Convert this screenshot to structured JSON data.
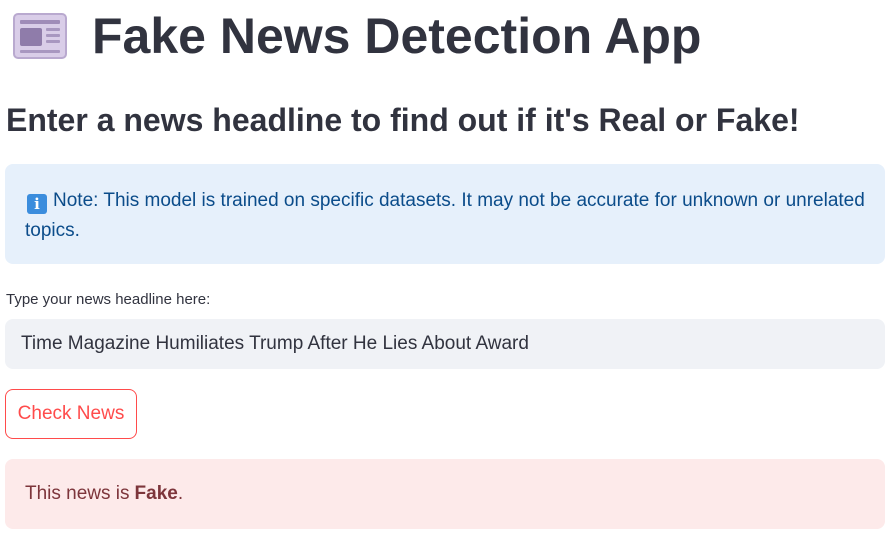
{
  "header": {
    "icon": "newspaper-icon",
    "title": "Fake News Detection App",
    "subtitle": "Enter a news headline to find out if it's Real or Fake!"
  },
  "info": {
    "icon": "info-icon",
    "icon_glyph": "i",
    "text": "Note: This model is trained on specific datasets. It may not be accurate for unknown or unrelated topics."
  },
  "form": {
    "label": "Type your news headline here:",
    "input_value": "Time Magazine Humiliates Trump After He Lies About Award",
    "button_label": "Check News"
  },
  "result": {
    "prefix": "This news is",
    "verdict": "Fake",
    "suffix": "."
  },
  "colors": {
    "accent": "#ff4b4b",
    "info_bg": "#e6f0fb",
    "error_bg": "#fdeaea",
    "input_bg": "#f0f2f6"
  }
}
